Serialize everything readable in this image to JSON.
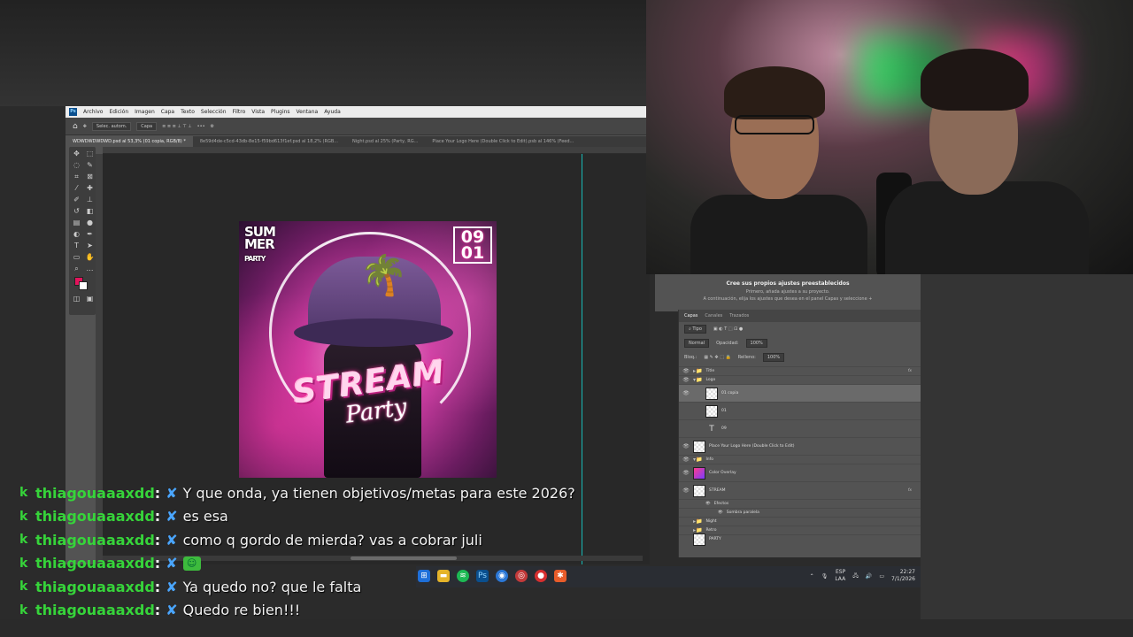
{
  "photoshop": {
    "logo": "Ps",
    "menu": [
      "Archivo",
      "Edición",
      "Imagen",
      "Capa",
      "Texto",
      "Selección",
      "Filtro",
      "Vista",
      "Plugins",
      "Ventana",
      "Ayuda"
    ],
    "options": {
      "auto_select": "Selec. autom.",
      "layer_dropdown": "Capa",
      "more": "•••"
    },
    "tabs": [
      "WDWDWDWDWD.psd al 53,3% (01 copia, RGB/8) *",
      "8e59d4de-c5cd-43db-8e15-f59bd613f1ef.psd al 18,2% (RGB...",
      "Night.psd al 25% (Party, RG...",
      "Place Your Logo Here (Double Click to Edit).psb al 146% (Feed..."
    ],
    "colors": {
      "foreground": "#e3145c",
      "background": "#ffffff",
      "guide": "#18b8b5"
    }
  },
  "artwork": {
    "corner_title": "SUM MER",
    "corner_sub": "PARTY",
    "date": "09 01",
    "headline": "STREAM",
    "subline": "Party"
  },
  "adjustments": {
    "title": "Cree sus propios ajustes preestablecidos",
    "line1": "Primero, añada ajustes a su proyecto.",
    "line2": "A continuación, elija los ajustes que desea en el panel Capas y seleccione +"
  },
  "layers_panel": {
    "tabs": [
      "Capas",
      "Canales",
      "Trazados"
    ],
    "filter": "Tipo",
    "blend": "Normal",
    "opacity_label": "Opacidad:",
    "opacity_value": "100%",
    "lock_label": "Bloq.:",
    "fill_label": "Relleno:",
    "fill_value": "100%",
    "rows": [
      {
        "name": "Title",
        "kind": "folder",
        "fx": "fx"
      },
      {
        "name": "Logo",
        "kind": "folder",
        "fx": ""
      },
      {
        "name": "01 copia",
        "kind": "image",
        "fx": ""
      },
      {
        "name": "01",
        "kind": "image",
        "fx": ""
      },
      {
        "name": "09",
        "kind": "text",
        "fx": ""
      },
      {
        "name": "Place Your Logo Here (Double Click to Edit)",
        "kind": "image",
        "fx": ""
      },
      {
        "name": "Info",
        "kind": "folder",
        "fx": ""
      },
      {
        "name": "Color Overlay",
        "kind": "gradient",
        "fx": ""
      },
      {
        "name": "STREAM",
        "kind": "image",
        "fx": "fx"
      },
      {
        "name": "Efectos",
        "kind": "effect",
        "fx": ""
      },
      {
        "name": "Sombra paralela",
        "kind": "effect",
        "fx": ""
      },
      {
        "name": "Night",
        "kind": "folder",
        "fx": ""
      },
      {
        "name": "Retro",
        "kind": "folder",
        "fx": ""
      },
      {
        "name": "PARTY",
        "kind": "image",
        "fx": ""
      }
    ]
  },
  "chat": [
    {
      "user": "thiagouaaaxdd",
      "text": "Y que onda, ya tienen objetivos/metas para este 2026?",
      "emote": ""
    },
    {
      "user": "thiagouaaaxdd",
      "text": "es esa",
      "emote": ""
    },
    {
      "user": "thiagouaaaxdd",
      "text": "como q gordo de mierda? vas a cobrar juli",
      "emote": ""
    },
    {
      "user": "thiagouaaaxdd",
      "text": "",
      "emote": "☺"
    },
    {
      "user": "thiagouaaaxdd",
      "text": "Ya quedo no? que le falta",
      "emote": ""
    },
    {
      "user": "thiagouaaaxdd",
      "text": "Quedo re bien!!!",
      "emote": ""
    }
  ],
  "taskbar": {
    "lang": "ESP",
    "lang2": "LAA",
    "time": "22:27",
    "date": "7/1/2026"
  }
}
